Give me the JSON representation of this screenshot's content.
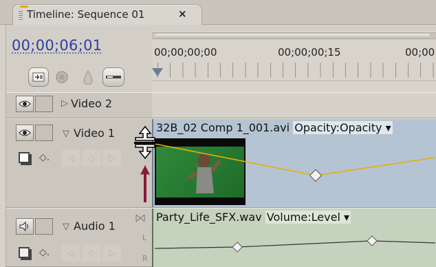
{
  "panel": {
    "tab_title": "Timeline: Sequence 01",
    "close_glyph": "×"
  },
  "timecode": "00;00;06;01",
  "ruler": {
    "labels": [
      "00;00;00;00",
      "00;00;00;15",
      "00;00"
    ]
  },
  "tracks": {
    "video2": {
      "name": "Video 2",
      "collapsed": true
    },
    "video1": {
      "name": "Video 1",
      "expanded": true
    },
    "audio1": {
      "name": "Audio 1",
      "expanded": true
    }
  },
  "clips": {
    "video1": {
      "name": "32B_02 Comp 1_001.avi",
      "property": "Opacity:Opacity"
    },
    "audio1": {
      "name": "Party_Life_SFX.wav",
      "property": "Volume:Level"
    }
  },
  "audio_channel_labels": [
    "L",
    "R"
  ],
  "colors": {
    "timecode": "#2b3fa8",
    "video_clip": "#b5c4d3",
    "audio_clip": "#c5d3be",
    "opacity_line": "#e8b000",
    "work_area": "#d33a2a",
    "cursor_arrow": "#8a1a3a"
  },
  "icons": [
    "snap-icon",
    "set-marker-icon",
    "keyframe-drop-icon",
    "toggle-sync-icon",
    "eye-icon",
    "speaker-icon",
    "set-display-icon",
    "show-keyframes-icon",
    "prev-keyframe-icon",
    "add-keyframe-icon",
    "next-keyframe-icon",
    "track-resize-cursor-icon",
    "up-arrow-icon"
  ]
}
